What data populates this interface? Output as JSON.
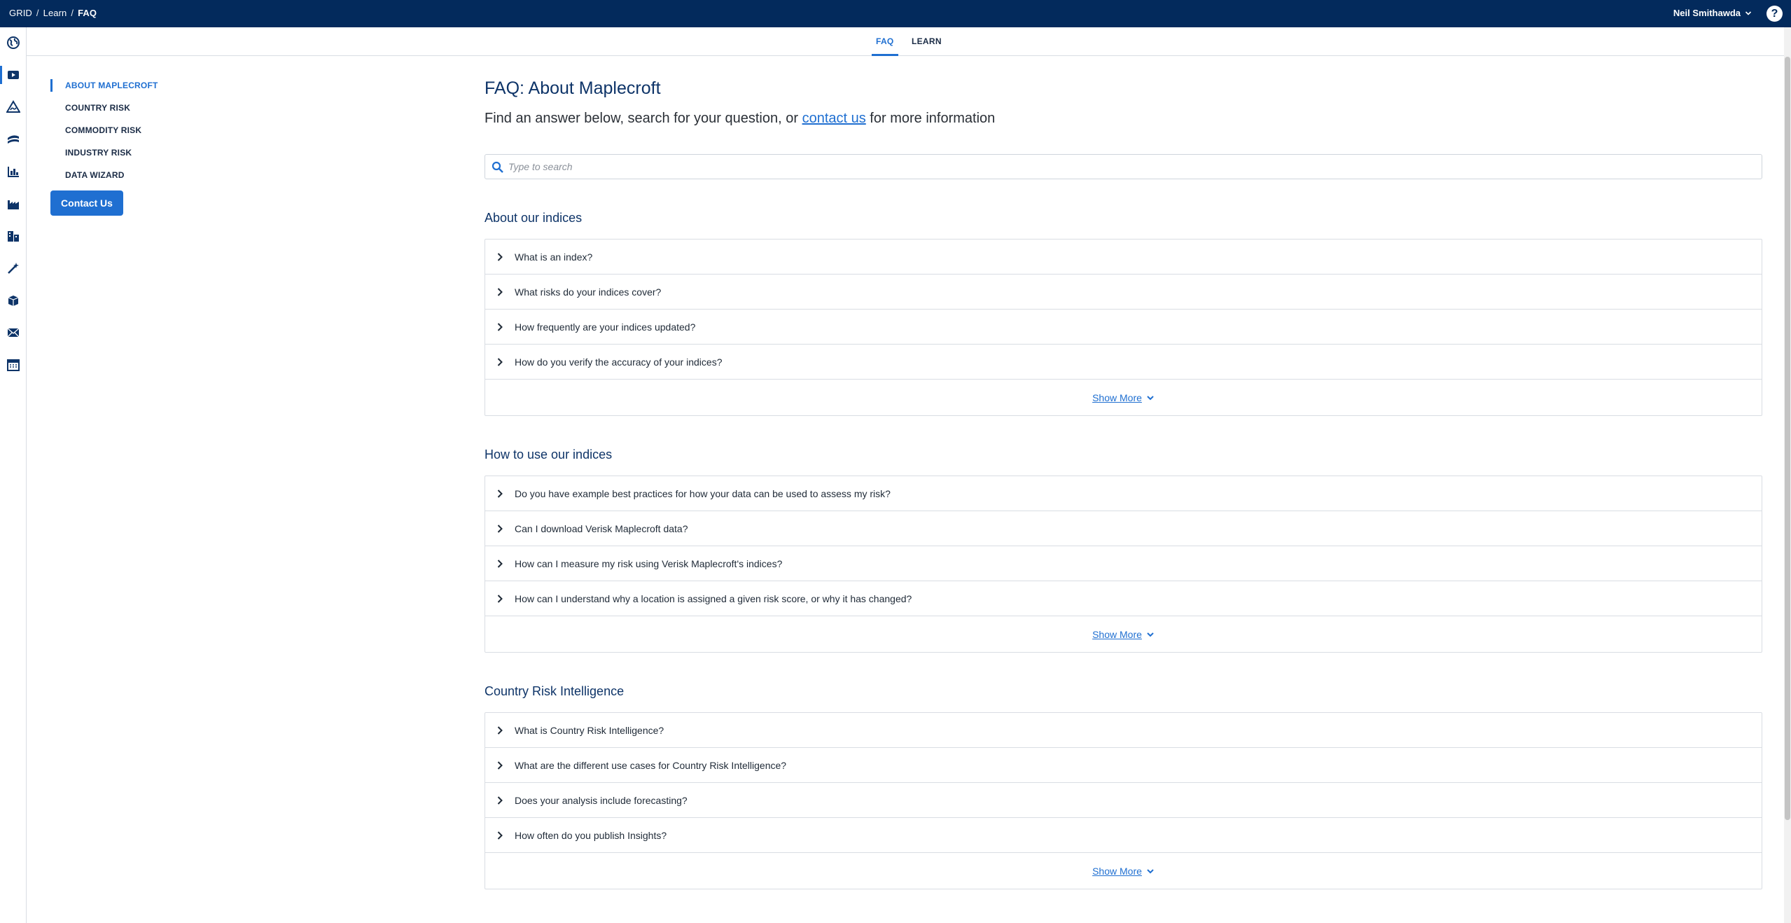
{
  "breadcrumb": [
    "GRID",
    "Learn",
    "FAQ"
  ],
  "user": {
    "name": "Neil Smithawda"
  },
  "help_label": "?",
  "rail_icons": [
    "globe-icon",
    "video-icon",
    "hazard-icon",
    "commodity-icon",
    "industry-chart-icon",
    "factory-icon",
    "buildings-icon",
    "wizard-icon",
    "boxes-icon",
    "mail-icon",
    "calendar-grid-icon"
  ],
  "tabs": [
    {
      "label": "FAQ",
      "active": true
    },
    {
      "label": "LEARN",
      "active": false
    }
  ],
  "sidenav": {
    "items": [
      {
        "label": "ABOUT MAPLECROFT",
        "active": true
      },
      {
        "label": "COUNTRY RISK",
        "active": false
      },
      {
        "label": "COMMODITY RISK",
        "active": false
      },
      {
        "label": "INDUSTRY RISK",
        "active": false
      },
      {
        "label": "DATA WIZARD",
        "active": false
      }
    ],
    "contact_label": "Contact Us"
  },
  "main": {
    "title": "FAQ: About Maplecroft",
    "subtitle_before": "Find an answer below, search for your question, or ",
    "subtitle_link": "contact us",
    "subtitle_after": " for more information",
    "search_placeholder": "Type to search",
    "show_more_label": "Show More",
    "sections": [
      {
        "heading": "About our indices",
        "questions": [
          "What is an index?",
          "What risks do your indices cover?",
          "How frequently are your indices updated?",
          "How do you verify the accuracy of your indices?"
        ]
      },
      {
        "heading": "How to use our indices",
        "questions": [
          "Do you have example best practices for how your data can be used to assess my risk?",
          "Can I download Verisk Maplecroft data?",
          "How can I measure my risk using Verisk Maplecroft's indices?",
          "How can I understand why a location is assigned a given risk score, or why it has changed?"
        ]
      },
      {
        "heading": "Country Risk Intelligence",
        "questions": [
          "What is Country Risk Intelligence?",
          "What are the different use cases for Country Risk Intelligence?",
          "Does your analysis include forecasting?",
          "How often do you publish Insights?"
        ]
      }
    ]
  },
  "colors": {
    "topbar": "#032a5c",
    "accent": "#1f6fd1",
    "heading": "#0e3468"
  }
}
